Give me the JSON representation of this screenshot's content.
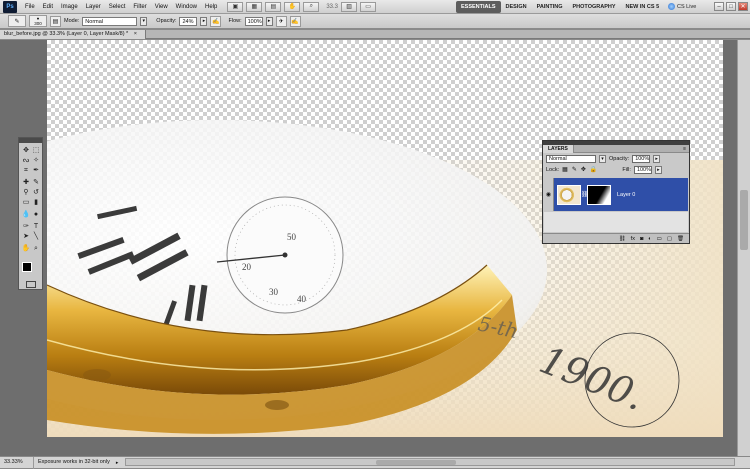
{
  "app": {
    "logo": "Ps",
    "menu": [
      "File",
      "Edit",
      "Image",
      "Layer",
      "Select",
      "Filter",
      "View",
      "Window",
      "Help"
    ],
    "zoom_field": "33.3",
    "workspaces": [
      "ESSENTIALS",
      "DESIGN",
      "PAINTING",
      "PHOTOGRAPHY",
      "NEW IN CS 5"
    ],
    "more": "»",
    "cs_live": "CS Live",
    "window_controls": [
      "–",
      "□",
      "✕"
    ]
  },
  "options": {
    "brush_size": "300",
    "mode_label": "Mode:",
    "mode_value": "Normal",
    "opacity_label": "Opacity:",
    "opacity_value": "24%",
    "flow_label": "Flow:",
    "flow_value": "100%"
  },
  "document": {
    "tab_title": "blur_before.jpg @ 33.3% (Layer 0, Layer Mask/8) *",
    "close": "×"
  },
  "canvas_text": {
    "handwriting_1": "5-th",
    "handwriting_2": "1900."
  },
  "status": {
    "zoom": "33.33%",
    "message": "Exposure works in 32-bit only"
  },
  "layers_panel": {
    "tab": "LAYERS",
    "blend_mode": "Normal",
    "opacity_label": "Opacity:",
    "opacity_value": "100%",
    "lock_label": "Lock:",
    "fill_label": "Fill:",
    "fill_value": "100%",
    "layer_name": "Layer 0",
    "footer_icons": [
      "link-icon",
      "fx-icon",
      "mask-icon",
      "adjustment-icon",
      "folder-icon",
      "new-layer-icon",
      "trash-icon"
    ]
  },
  "colors": {
    "selection_blue": "#2f4fa8",
    "ui_gray": "#c8c8c8",
    "gold": "#d9a63a"
  }
}
